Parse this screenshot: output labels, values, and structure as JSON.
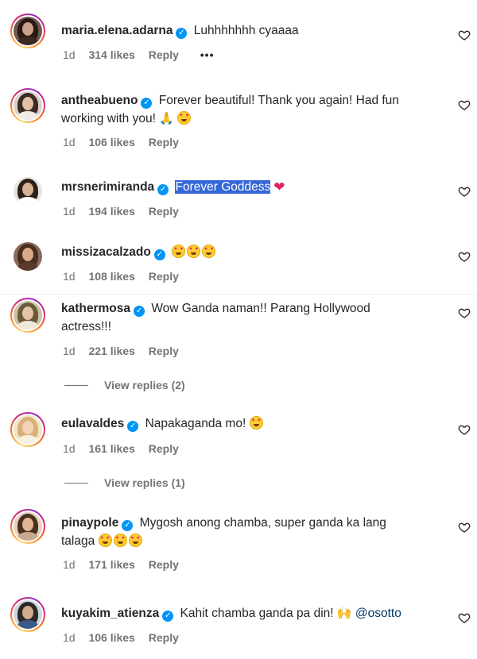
{
  "heart_icon": "heart-outline-icon",
  "comments": [
    {
      "username": "maria.elena.adarna",
      "verified": true,
      "text": "Luhhhhhhh cyaaaa",
      "time": "1d",
      "likes": "314 likes",
      "reply": "Reply",
      "more": "•••"
    },
    {
      "username": "antheabueno",
      "verified": true,
      "text_line1": "Forever beautiful! Thank you again! Had fun",
      "text_line2": "working with you!",
      "emojis": [
        "folded-hands-emoji",
        "smiling-face-with-hearts-emoji"
      ],
      "time": "1d",
      "likes": "106 likes",
      "reply": "Reply"
    },
    {
      "username": "mrsnerimiranda",
      "verified": true,
      "text": "Forever Goddess",
      "emojis": [
        "red-heart-emoji"
      ],
      "time": "1d",
      "likes": "194 likes",
      "reply": "Reply"
    },
    {
      "username": "missizacalzado",
      "verified": true,
      "emojis": [
        "heart-eyes-emoji",
        "heart-eyes-emoji",
        "heart-eyes-emoji"
      ],
      "time": "1d",
      "likes": "108 likes",
      "reply": "Reply"
    },
    {
      "username": "kathermosa",
      "verified": true,
      "text_line1": "Wow Ganda naman!! Parang Hollywood",
      "text_line2": "actress!!!",
      "time": "1d",
      "likes": "221 likes",
      "reply": "Reply",
      "view_replies": "View replies (2)"
    },
    {
      "username": "eulavaldes",
      "verified": true,
      "text": "Napakaganda mo!",
      "emojis": [
        "heart-eyes-emoji"
      ],
      "time": "1d",
      "likes": "161 likes",
      "reply": "Reply",
      "view_replies": "View replies (1)"
    },
    {
      "username": "pinaypole",
      "verified": true,
      "text_line1": "Mygosh anong chamba, super ganda ka lang",
      "text_line2": "talaga",
      "emojis": [
        "heart-eyes-emoji",
        "heart-eyes-emoji",
        "heart-eyes-emoji"
      ],
      "time": "1d",
      "likes": "171 likes",
      "reply": "Reply"
    },
    {
      "username": "kuyakim_atienza",
      "verified": true,
      "text": "Kahit chamba ganda pa din!",
      "emojis": [
        "raising-hands-emoji"
      ],
      "mention": "@osotto",
      "time": "1d",
      "likes": "106 likes",
      "reply": "Reply"
    }
  ],
  "colors": {
    "text": "#262626",
    "secondary": "#737373",
    "verified_blue": "#0095f6",
    "selection": "#3367d6",
    "mention": "#00376b"
  }
}
